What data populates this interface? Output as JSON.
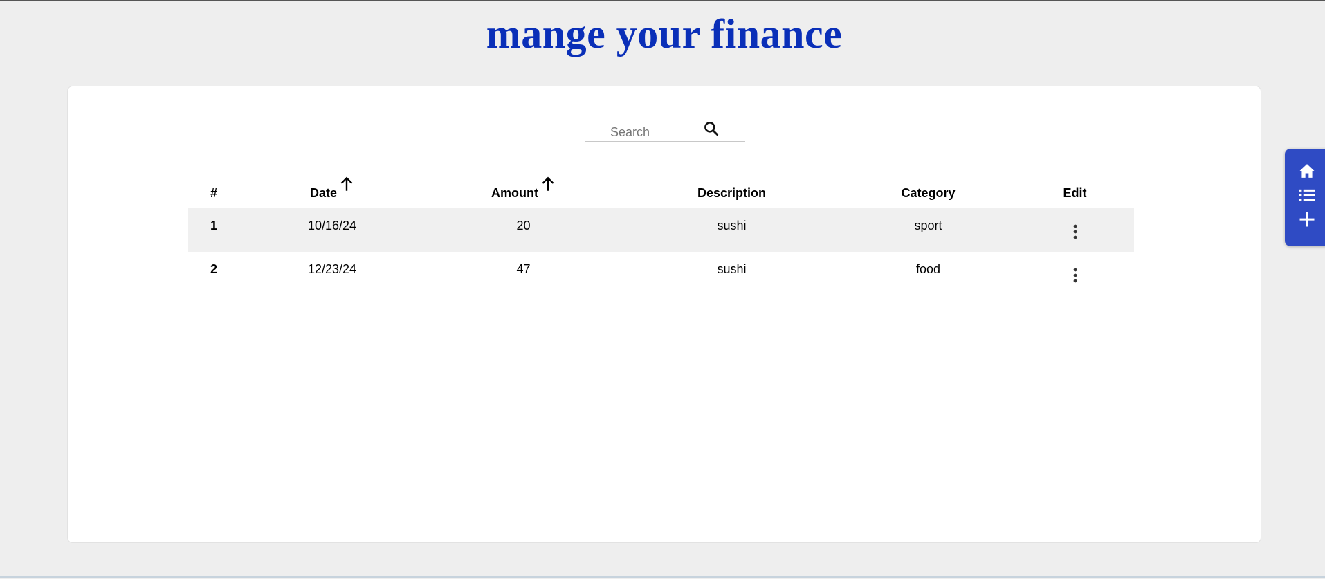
{
  "header": {
    "title": "mange your finance"
  },
  "search": {
    "placeholder": "Search",
    "value": ""
  },
  "table": {
    "columns": [
      "#",
      "Date",
      "Amount",
      "Description",
      "Category",
      "Edit"
    ],
    "rows": [
      {
        "num": "1",
        "date": "10/16/24",
        "amount": "20",
        "description": "sushi",
        "category": "sport"
      },
      {
        "num": "2",
        "date": "12/23/24",
        "amount": "47",
        "description": "sushi",
        "category": "food"
      }
    ]
  },
  "icons": {
    "search": "search-icon",
    "sort": "arrow-up-icon",
    "row_menu": "more-vertical-icon",
    "nav": [
      "home-icon",
      "list-icon",
      "plus-icon"
    ]
  },
  "colors": {
    "title": "#0a2fb8",
    "side_nav": "#2f4bc4",
    "page_bg": "#eeeeee",
    "row_alt": "#f0f0f0"
  }
}
